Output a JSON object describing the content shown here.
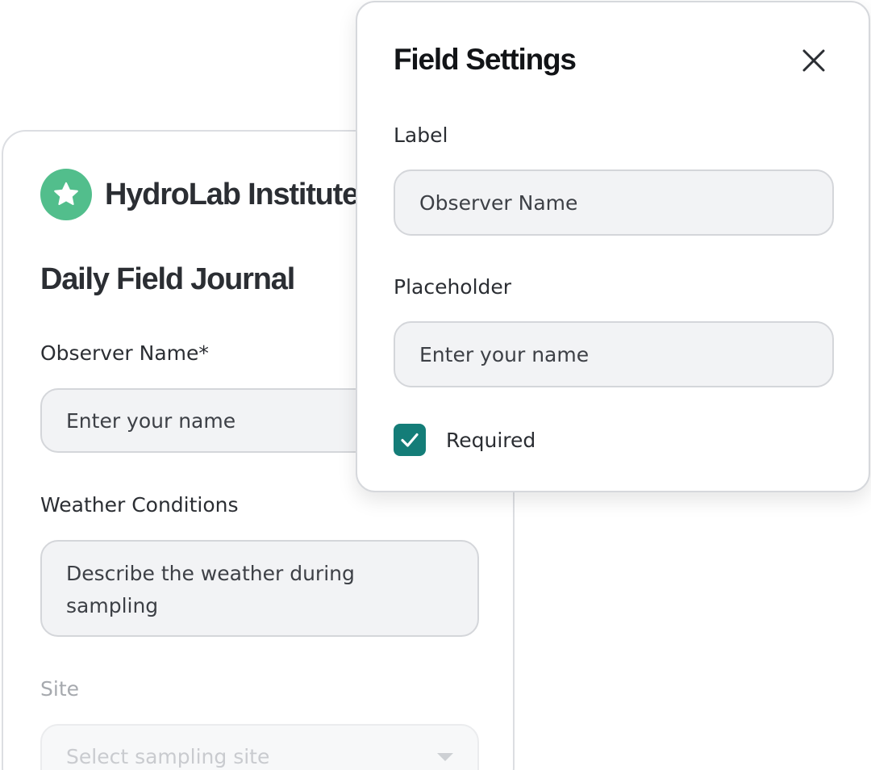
{
  "colors": {
    "brand_accent": "#52be8c",
    "checkbox_fill": "#147d78"
  },
  "form": {
    "brand": {
      "name": "HydroLab Institute",
      "logo_icon": "star-icon"
    },
    "title": "Daily Field Journal",
    "fields": [
      {
        "label": "Observer Name*",
        "placeholder": "Enter your name",
        "type": "text"
      },
      {
        "label": "Weather Conditions",
        "placeholder": "Describe the weather during sampling",
        "type": "textarea"
      },
      {
        "label": "Site",
        "placeholder": "Select sampling site",
        "type": "select",
        "disabled": true,
        "icon": "chevron-down-icon"
      }
    ]
  },
  "settings": {
    "title": "Field Settings",
    "close_icon": "close-icon",
    "label_heading": "Label",
    "label_value": "Observer Name",
    "placeholder_heading": "Placeholder",
    "placeholder_value": "Enter your name",
    "required_label": "Required",
    "required_checked": true
  }
}
